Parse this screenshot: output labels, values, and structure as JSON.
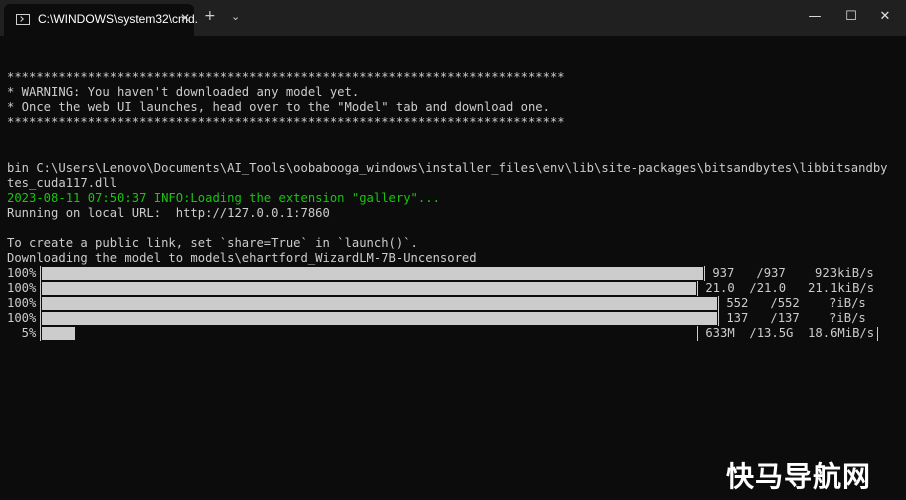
{
  "titlebar": {
    "tab_title": "C:\\WINDOWS\\system32\\cmd.",
    "tab_close": "✕",
    "new_tab": "+",
    "dropdown": "⌄",
    "minimize": "—",
    "maximize": "☐",
    "close": "✕"
  },
  "terminal": {
    "stars": "****************************************************************************",
    "warning1": "* WARNING: You haven't downloaded any model yet.",
    "warning2": "* Once the web UI launches, head over to the \"Model\" tab and download one.",
    "bin1": "bin C:\\Users\\Lenovo\\Documents\\AI_Tools\\oobabooga_windows\\installer_files\\env\\lib\\site-packages\\bitsandbytes\\libbitsandby",
    "bin2": "tes_cuda117.dll",
    "info": "2023-08-11 07:50:37 INFO:Loading the extension \"gallery\"...",
    "running": "Running on local URL:  http://127.0.0.1:7860",
    "public": "To create a public link, set `share=True` in `launch()`.",
    "downloading": "Downloading the model to models\\ehartford_WizardLM-7B-Uncensored",
    "progress": [
      {
        "pct": "100%",
        "fill": 1.0,
        "stats": " 937   /937    923kiB/s"
      },
      {
        "pct": "100%",
        "fill": 1.0,
        "stats": " 21.0  /21.0   21.1kiB/s"
      },
      {
        "pct": "100%",
        "fill": 1.0,
        "stats": " 552   /552    ?iB/s"
      },
      {
        "pct": "100%",
        "fill": 1.0,
        "stats": " 137   /137    ?iB/s"
      },
      {
        "pct": "  5%",
        "fill": 0.05,
        "stats": " 633M  /13.5G  18.6MiB/s"
      }
    ]
  },
  "watermark": "快马导航网",
  "colors": {
    "background": "#0c0c0c",
    "titlebar": "#202020",
    "text": "#cccccc",
    "info_green": "#16c60c"
  }
}
